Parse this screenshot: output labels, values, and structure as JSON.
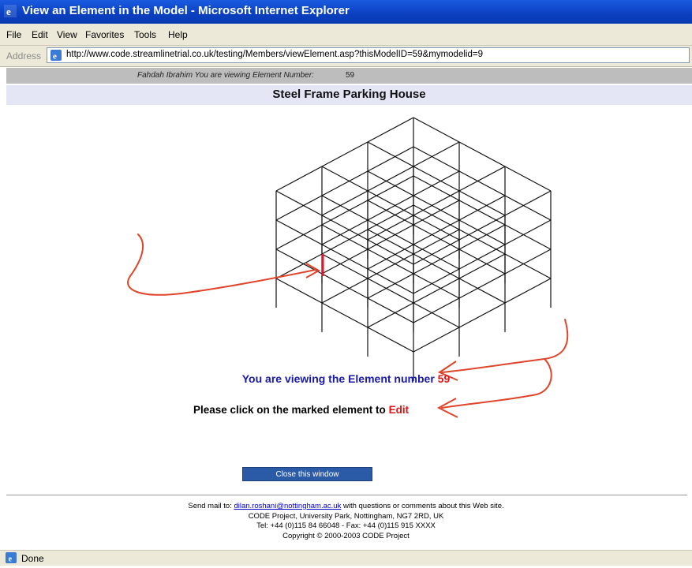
{
  "window": {
    "title": "View an Element in the Model - Microsoft Internet Explorer"
  },
  "menu": {
    "items": [
      "File",
      "Edit",
      "View",
      "Favorites",
      "Tools",
      "Help"
    ]
  },
  "address": {
    "label": "Address",
    "url": "http://www.code.streamlinetrial.co.uk/testing/Members/viewElement.asp?thisModelID=59&mymodelid=9"
  },
  "info": {
    "viewer_text": "Fahdah Ibrahim You are viewing Element Number:",
    "element_number": "59"
  },
  "page": {
    "heading": "Steel Frame Parking House",
    "viewing_prefix": "You are viewing the Element number",
    "viewing_number": "59",
    "click_prefix": "Please click on the marked element to",
    "edit_link": "Edit",
    "close_button": "Close this window"
  },
  "footer": {
    "mail_prefix": "Send mail to:",
    "mail_address": "dilan.roshani@nottingham.ac.uk",
    "mail_suffix": "with questions or comments about this Web site.",
    "address_line": "CODE Project, University Park, Nottingham, NG7 2RD, UK",
    "tel_line": "Tel: +44 (0)115 84 66048 - Fax: +44 (0)115 915 XXXX",
    "copyright": "Copyright © 2000-2003 CODE Project"
  },
  "status": {
    "text": "Done"
  },
  "colors": {
    "titlebar": "#0a3fc0",
    "highlight_element": "#e0142c",
    "annotation_arrows": "#e0442a",
    "link_blue": "#1a1aa8",
    "edit_red": "#e01414"
  }
}
